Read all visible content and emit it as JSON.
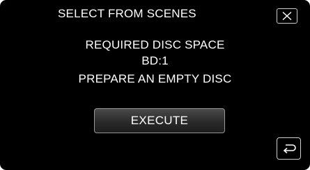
{
  "header": {
    "title": "SELECT FROM SCENES",
    "close_icon": "close-x-icon"
  },
  "message": {
    "line1": "REQUIRED DISC SPACE",
    "line2": "BD:1",
    "line3": "PREPARE AN EMPTY DISC"
  },
  "actions": {
    "execute_label": "EXECUTE",
    "back_icon": "return-arrow-icon"
  },
  "colors": {
    "background": "#000000",
    "text": "#ffffff",
    "button_border": "#9a9a9a"
  }
}
